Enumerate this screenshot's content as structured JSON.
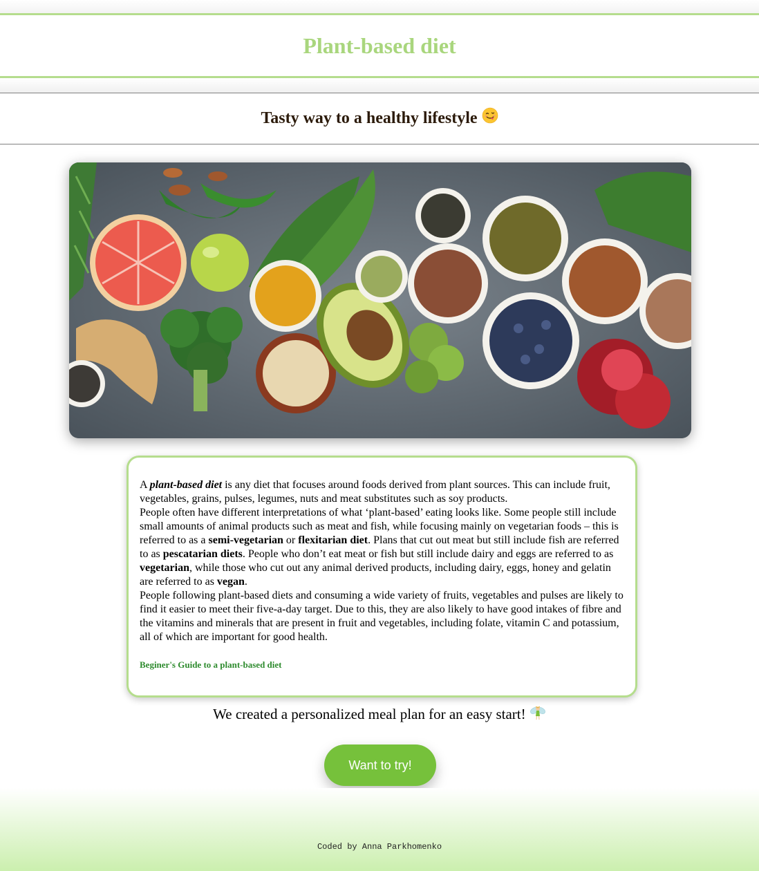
{
  "header": {
    "title": "Plant-based diet"
  },
  "subheader": {
    "title": "Tasty way to a healthy lifestyle"
  },
  "card": {
    "p1_a": "A ",
    "p1_term": "plant-based diet",
    "p1_b": " is any diet that focuses around foods derived from plant sources. This can include fruit, vegetables, grains, pulses, legumes, nuts and meat substitutes such as soy products.",
    "p2_a": "People often have different interpretations of what ‘plant-based’ eating looks like. Some people still include small amounts of animal products such as meat and fish, while focusing mainly on vegetarian foods – this is referred to as a ",
    "p2_b1": "semi-vegetarian",
    "p2_c": " or ",
    "p2_b2": "flexitarian diet",
    "p2_d": ". Plans that cut out meat but still include fish are referred to as ",
    "p2_b3": "pescatarian diets",
    "p2_e": ". People who don’t eat meat or fish but still include dairy and eggs are referred to as ",
    "p2_b4": "vegetarian",
    "p2_f": ", while those who cut out any animal derived products, including dairy, eggs, honey and gelatin are referred to as ",
    "p2_b5": "vegan",
    "p2_g": ".",
    "p3": "People following plant-based diets and consuming a wide variety of fruits, vegetables and pulses are likely to find it easier to meet their five-a-day target. Due to this, they are also likely to have good intakes of fibre and the vitamins and minerals that are present in fruit and vegetables, including folate, vitamin C and potassium, all of which are important for good health.",
    "link": "Beginer's Guide to a plant-based diet"
  },
  "cta": {
    "text": "We created a personalized meal plan for an easy start!",
    "button": "Want to try!"
  },
  "footer": {
    "credit": "Coded by Anna Parkhomenko"
  },
  "icons": {
    "subheader": "smiling-face-tongue-emoji",
    "cta": "fairy-emoji",
    "hero": "vegetables-photo"
  },
  "colors": {
    "accent": "#b5dd8d",
    "title": "#a9d67d",
    "button": "#76c13b",
    "link": "#2e8b2e"
  }
}
